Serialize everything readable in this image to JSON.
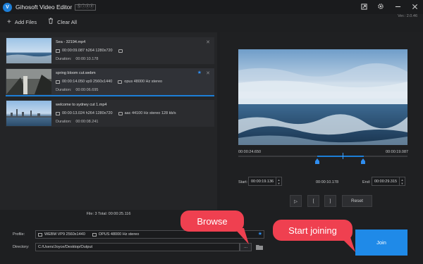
{
  "app": {
    "logo": "V",
    "title": "Gihosoft Video Editor",
    "badge": "Ⓢⓘⓝⓔ",
    "version": "Ver.: 2.0.46"
  },
  "titlebar_icons": [
    "share-icon",
    "gear-icon",
    "minimize-icon",
    "close-icon"
  ],
  "toolbar": {
    "add_files": "Add Files",
    "clear_all": "Clear All"
  },
  "clips": [
    {
      "name": "Sea - 32194.mp4",
      "video": "00:00:09.087 h264 1280x720",
      "audio": "",
      "duration_label": "Duration:",
      "duration": "00:00:10.178",
      "starred": false,
      "selected": false
    },
    {
      "name": "spring bloom cut.webm",
      "video": "00:00:14.050 vp9 2560x1440",
      "audio": "opus 48000 Hz stereo",
      "duration_label": "Duration:",
      "duration": "00:00:06.695",
      "starred": true,
      "selected": true
    },
    {
      "name": "welcome to sydney cut 1.mp4",
      "video": "00:00:13.024 h264 1280x720",
      "audio": "aac 44100 Hz stereo 128 kb/s",
      "duration_label": "Duration:",
      "duration": "00:00:08.241",
      "starred": false,
      "selected": false
    }
  ],
  "timeline": {
    "start": "00:00:24.650",
    "end": "00:00:19.087"
  },
  "trim": {
    "start_label": "Start:",
    "start": "00:00:19.136",
    "length": "00:00:10.178",
    "end_label": "End:",
    "end": "00:00:29.315"
  },
  "controls": {
    "play": "▷",
    "mark_in": "[",
    "mark_out": "]",
    "reset": "Reset"
  },
  "summary": "File: 3   Total: 00:00:25.116",
  "profile": {
    "label": "Profile:",
    "video": "WEBM VP9 2560x1440",
    "audio": "OPUS 48000 Hz stereo"
  },
  "directory": {
    "label": "Directory:",
    "value": "C:/Users/Joyce/Desktop/Output",
    "browse_btn": "..."
  },
  "join_label": "Join",
  "callouts": {
    "browse": "Browse",
    "start_joining": "Start joining"
  },
  "colors": {
    "accent": "#1f8ae8",
    "callout": "#ef4050"
  }
}
